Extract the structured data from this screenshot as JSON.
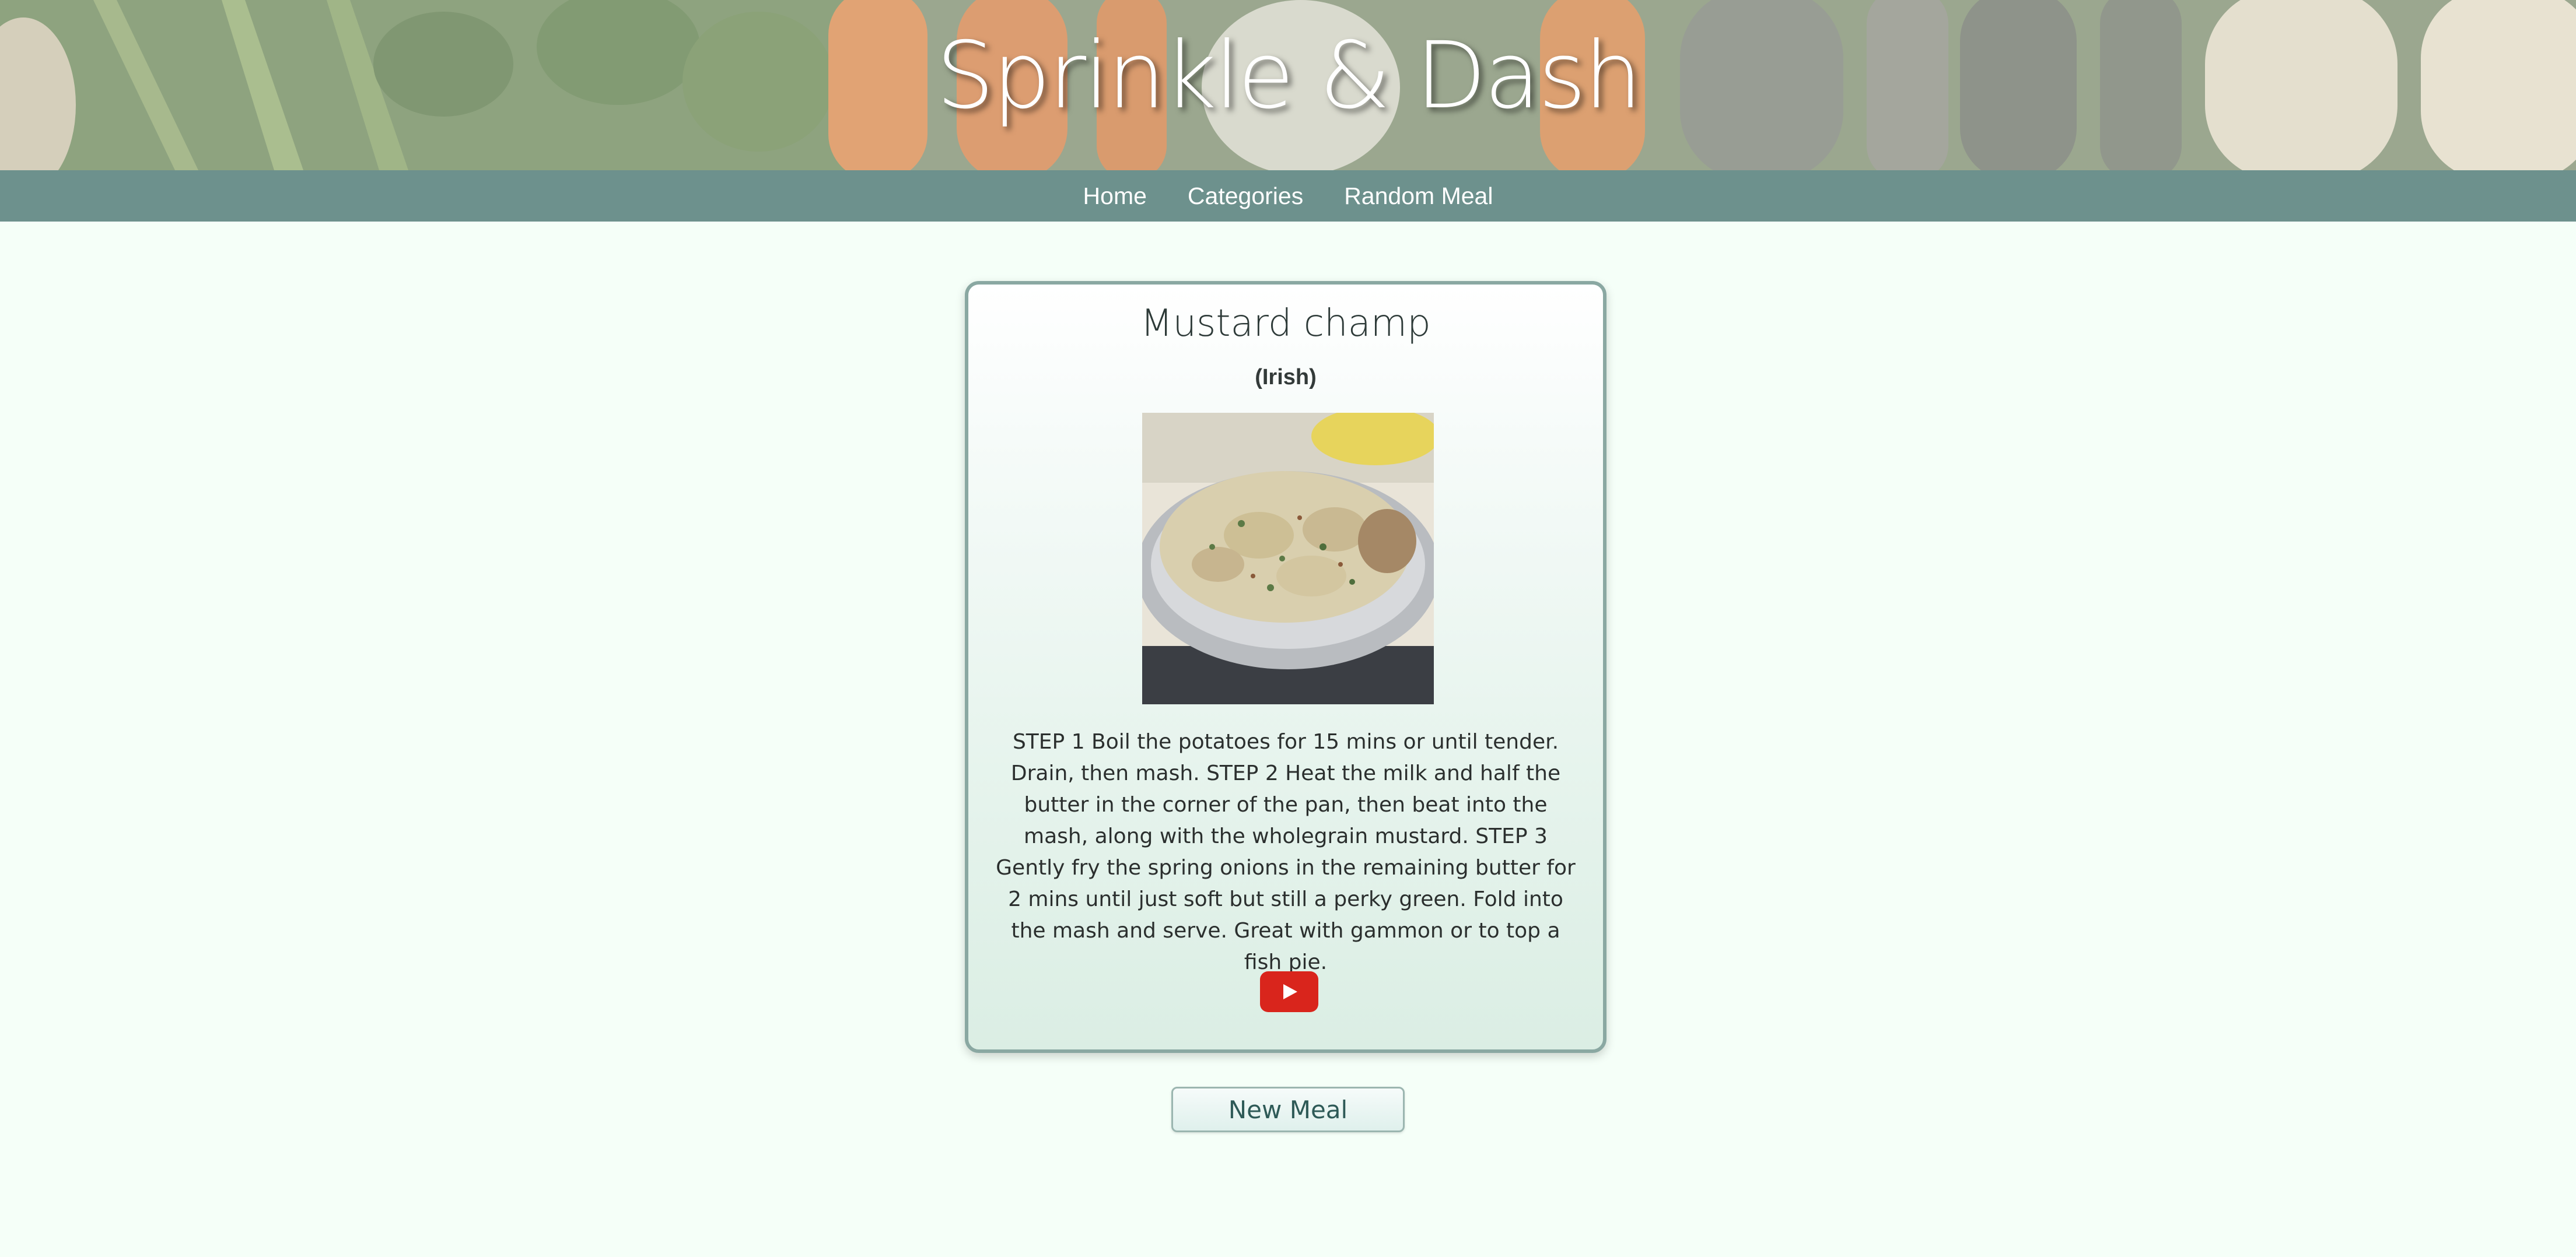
{
  "site": {
    "title": "Sprinkle & Dash"
  },
  "nav": {
    "items": [
      {
        "label": "Home"
      },
      {
        "label": "Categories"
      },
      {
        "label": "Random Meal"
      }
    ]
  },
  "meal": {
    "name": "Mustard champ",
    "area": "(Irish)",
    "image_icon": "mashed-potato-bowl",
    "instructions": "STEP 1 Boil the potatoes for 15 mins or until tender. Drain, then mash. STEP 2 Heat the milk and half the butter in the corner of the pan, then beat into the mash, along with the wholegrain mustard. STEP 3 Gently fry the spring onions in the remaining butter for 2 mins until just soft but still a perky green. Fold into the mash and serve. Great with gammon or to top a fish pie.",
    "video_icon": "youtube-play-icon"
  },
  "actions": {
    "new_meal_label": "New Meal"
  },
  "colors": {
    "nav_background": "#6d918d",
    "page_background": "#f5fff8",
    "card_border": "#8aa8a2",
    "youtube_red": "#d9251c",
    "button_text": "#2e5a57"
  }
}
